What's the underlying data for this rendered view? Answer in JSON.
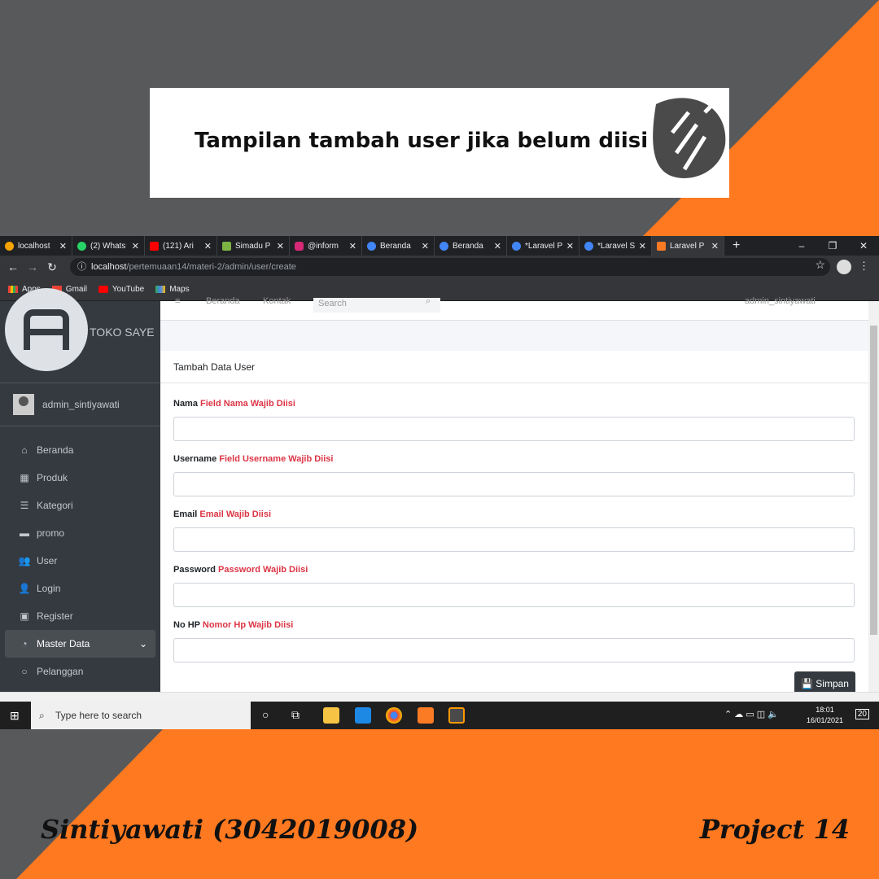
{
  "colors": {
    "accent": "#ff7920",
    "gray": "#58595b",
    "sidebar": "#343a40"
  },
  "title": "Tampilan tambah user jika belum diisi",
  "browser": {
    "tabs": [
      "localhost",
      "(2) Whats",
      "(121) Ari",
      "Simadu P",
      "@inform",
      "Beranda",
      "Beranda",
      "*Laravel P",
      "*Laravel S",
      "Laravel P"
    ],
    "new_tab": "+",
    "url_host": "localhost",
    "url_path": "/pertemuaan14/materi-2/admin/user/create",
    "bookmarks": [
      "Apps",
      "Gmail",
      "YouTube",
      "Maps"
    ]
  },
  "sidebar": {
    "brand": "TOKO SAYE",
    "user": "admin_sintiyawati",
    "items": [
      {
        "label": "Beranda",
        "icon": "home-icon"
      },
      {
        "label": "Produk",
        "icon": "grid-icon"
      },
      {
        "label": "Kategori",
        "icon": "list-icon"
      },
      {
        "label": "promo",
        "icon": "wallet-icon"
      },
      {
        "label": "User",
        "icon": "users-icon"
      },
      {
        "label": "Login",
        "icon": "user-icon"
      },
      {
        "label": "Register",
        "icon": "register-icon"
      },
      {
        "label": "Master Data",
        "icon": "dashboard-icon"
      },
      {
        "label": "Pelanggan",
        "icon": "circle-icon"
      }
    ]
  },
  "topnav": {
    "menu": "≡",
    "home": "Beranda",
    "contact": "Kontak",
    "search_placeholder": "Search",
    "user": "admin_sintiyawati"
  },
  "form": {
    "card_title": "Tambah Data User",
    "fields": [
      {
        "label": "Nama",
        "error": "Field Nama Wajib Diisi"
      },
      {
        "label": "Username",
        "error": "Field Username Wajib Diisi"
      },
      {
        "label": "Email",
        "error": "Email Wajib Diisi"
      },
      {
        "label": "Password",
        "error": "Password Wajib Diisi"
      },
      {
        "label": "No HP",
        "error": "Nomor Hp Wajib Diisi"
      }
    ],
    "save_label": "Simpan"
  },
  "taskbar": {
    "search_placeholder": "Type here to search",
    "time": "18:01",
    "date": "16/01/2021",
    "notif": "20"
  },
  "footer": {
    "author": "Sintiyawati (3042019008)",
    "project": "Project 14"
  }
}
